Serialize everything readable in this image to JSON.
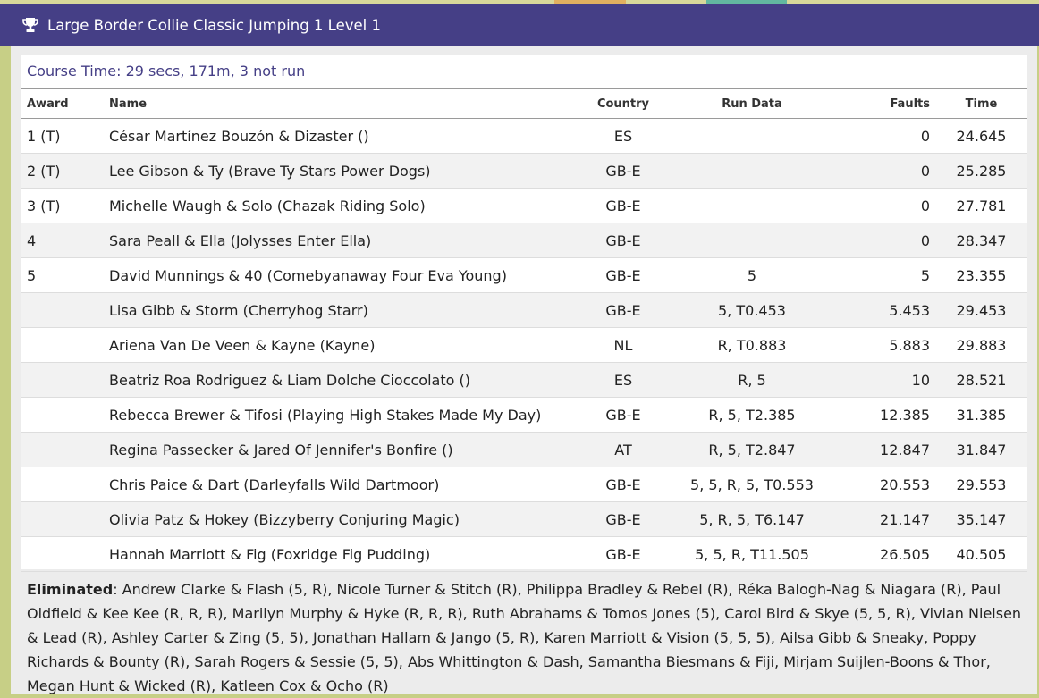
{
  "header": {
    "title": "Large Border Collie Classic Jumping 1 Level 1",
    "icon": "trophy-icon"
  },
  "course_time": "Course Time: 29 secs, 171m, 3 not run",
  "columns": [
    "Award",
    "Name",
    "Country",
    "Run Data",
    "Faults",
    "Time"
  ],
  "rows": [
    {
      "award": "1 (T)",
      "name": "César Martínez Bouzón & Dizaster ()",
      "country": "ES",
      "run": "",
      "faults": "0",
      "time": "24.645"
    },
    {
      "award": "2 (T)",
      "name": "Lee Gibson & Ty (Brave Ty Stars Power Dogs)",
      "country": "GB-E",
      "run": "",
      "faults": "0",
      "time": "25.285"
    },
    {
      "award": "3 (T)",
      "name": "Michelle Waugh & Solo (Chazak Riding Solo)",
      "country": "GB-E",
      "run": "",
      "faults": "0",
      "time": "27.781"
    },
    {
      "award": "4",
      "name": "Sara Peall & Ella (Jolysses Enter Ella)",
      "country": "GB-E",
      "run": "",
      "faults": "0",
      "time": "28.347"
    },
    {
      "award": "5",
      "name": "David Munnings & 40 (Comebyanaway Four Eva Young)",
      "country": "GB-E",
      "run": "5",
      "faults": "5",
      "time": "23.355"
    },
    {
      "award": "",
      "name": "Lisa Gibb & Storm (Cherryhog Starr)",
      "country": "GB-E",
      "run": "5, T0.453",
      "faults": "5.453",
      "time": "29.453"
    },
    {
      "award": "",
      "name": "Ariena Van De Veen & Kayne (Kayne)",
      "country": "NL",
      "run": "R, T0.883",
      "faults": "5.883",
      "time": "29.883"
    },
    {
      "award": "",
      "name": "Beatriz Roa Rodriguez & Liam Dolche Cioccolato ()",
      "country": "ES",
      "run": "R, 5",
      "faults": "10",
      "time": "28.521"
    },
    {
      "award": "",
      "name": "Rebecca Brewer & Tifosi (Playing High Stakes Made My Day)",
      "country": "GB-E",
      "run": "R, 5, T2.385",
      "faults": "12.385",
      "time": "31.385"
    },
    {
      "award": "",
      "name": "Regina Passecker & Jared Of Jennifer's Bonfire ()",
      "country": "AT",
      "run": "R, 5, T2.847",
      "faults": "12.847",
      "time": "31.847"
    },
    {
      "award": "",
      "name": "Chris Paice & Dart (Darleyfalls Wild Dartmoor)",
      "country": "GB-E",
      "run": "5, 5, R, 5, T0.553",
      "faults": "20.553",
      "time": "29.553"
    },
    {
      "award": "",
      "name": "Olivia Patz & Hokey (Bizzyberry Conjuring Magic)",
      "country": "GB-E",
      "run": "5, R, 5, T6.147",
      "faults": "21.147",
      "time": "35.147"
    },
    {
      "award": "",
      "name": "Hannah Marriott & Fig (Foxridge Fig Pudding)",
      "country": "GB-E",
      "run": "5, 5, R, T11.505",
      "faults": "26.505",
      "time": "40.505"
    }
  ],
  "eliminated": {
    "label": "Eliminated",
    "text": ": Andrew Clarke & Flash (5, R), Nicole Turner & Stitch (R), Philippa Bradley & Rebel (R), Réka Balogh-Nag & Niagara (R), Paul Oldfield & Kee Kee (R, R, R), Marilyn Murphy & Hyke (R, R, R), Ruth Abrahams & Tomos Jones (5), Carol Bird & Skye (5, 5, R), Vivian Nielsen & Lead (R), Ashley Carter & Zing (5, 5), Jonathan Hallam & Jango (5, R), Karen Marriott & Vision (5, 5, 5), Ailsa Gibb & Sneaky, Poppy Richards & Bounty (R), Sarah Rogers & Sessie (5, 5), Abs Whittington & Dash, Samantha Biesmans & Fiji, Mirjam Suijlen-Boons & Thor, Megan Hunt & Wicked (R), Katleen Cox & Ocho (R)"
  }
}
